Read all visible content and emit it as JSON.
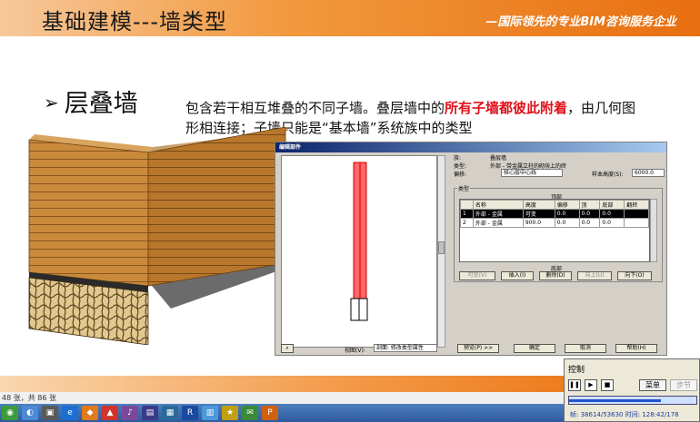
{
  "slide": {
    "title": "基础建模---墙类型",
    "slogan": "—国际领先的专业BIM咨询服务企业",
    "bullet": "层叠墙",
    "desc_part1": "包含若干相互堆叠的不同子墙。叠层墙中的",
    "desc_highlight": "所有子墙都彼此附着",
    "desc_part2": "，由几何图形相连接；子墙只能是“基本墙”系统族中的类型"
  },
  "dialog": {
    "title": "编辑部件",
    "family_label": "族:",
    "family_value": "叠层墙",
    "type_label": "类型:",
    "type_value": "外部 - 带金属立柱的砌块上的砖",
    "offset_label": "偏移:",
    "offset_value": "核心层中心线",
    "sample_height_label": "样本高度(S):",
    "sample_height_value": "6000.0",
    "types_group": "类型",
    "top_label": "顶部",
    "bottom_label": "底部",
    "columns": [
      "",
      "名称",
      "高度",
      "偏移",
      "顶",
      "底部",
      "翻转"
    ],
    "rows": [
      [
        "1",
        "外部 - 金属",
        "可变",
        "0.0",
        "0.0",
        "0.0",
        ""
      ],
      [
        "2",
        "外部 - 金属",
        "900.0",
        "0.0",
        "0.0",
        "0.0",
        ""
      ]
    ],
    "btn_variable": "可变(V)",
    "btn_insert": "插入(I)",
    "btn_delete": "删除(D)",
    "btn_up": "向上(U)",
    "btn_down": "向下(O)",
    "view_label": "视图(V):",
    "view_value": "剖面: 修改类型属性",
    "btn_preview": "预览(P) >>",
    "btn_ok": "确定",
    "btn_cancel": "取消",
    "btn_help": "帮助(H)"
  },
  "status": {
    "text": "48 张，共 86 张"
  },
  "control": {
    "title": "控制",
    "menu": "菜单",
    "step": "步节",
    "frame_info": "帧: 38614/53630 时间: 128:42/178",
    "progress": 0.72
  },
  "colors": {
    "accent_orange": "#ee7d20",
    "highlight_red": "#e0101a",
    "wall_red": "#ff6666"
  }
}
